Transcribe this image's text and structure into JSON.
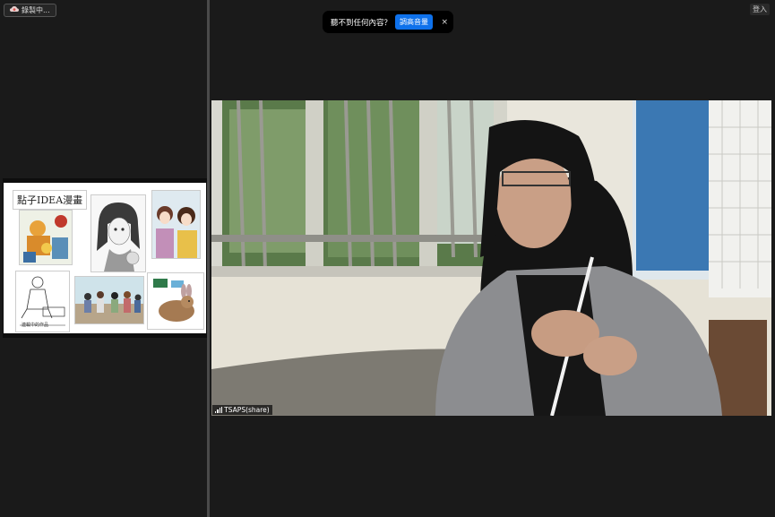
{
  "recording": {
    "label": "錄製中..."
  },
  "top_right": {
    "login": "登入"
  },
  "notice": {
    "message": "聽不到任何內容？",
    "button": "調高音量",
    "close": "×"
  },
  "shared_screen": {
    "title": "點子IDEA漫畫",
    "bottom_caption": "連載中的作品"
  },
  "video": {
    "participant_name": "TSAPS(share)"
  }
}
